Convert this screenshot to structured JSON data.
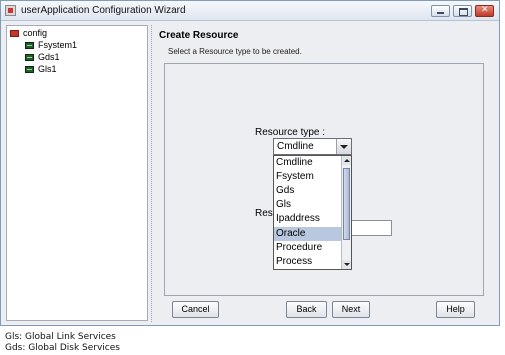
{
  "window": {
    "title": "userApplication Configuration Wizard"
  },
  "tree": {
    "root": "config",
    "children": [
      "Fsystem1",
      "Gds1",
      "Gls1"
    ]
  },
  "panel": {
    "title": "Create Resource",
    "subtitle": "Select a Resource type to be created.",
    "resource_type_label": "Resource type   :",
    "resource_type_value": "Cmdline",
    "resource_name_label": "Reso",
    "options": [
      "Cmdline",
      "Fsystem",
      "Gds",
      "Gls",
      "Ipaddress",
      "Oracle",
      "Procedure",
      "Process"
    ],
    "selected_option": "Oracle"
  },
  "buttons": {
    "cancel": "Cancel",
    "back": "Back",
    "next": "Next",
    "help": "Help"
  },
  "footnotes": [
    "Gls: Global Link Services",
    "Gds: Global Disk Services"
  ]
}
